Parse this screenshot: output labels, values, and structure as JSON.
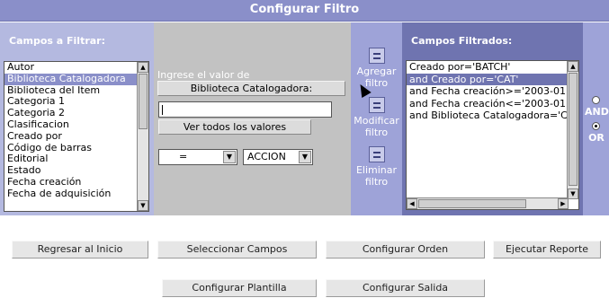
{
  "title": "Configurar Filtro",
  "left": {
    "header": "Campos a Filtrar:",
    "items": [
      "Autor",
      "Biblioteca Catalogadora",
      "Biblioteca del Item",
      "Categoria 1",
      "Categoria 2",
      "Clasificacion",
      "Creado por",
      "Código de barras",
      "Editorial",
      "Estado",
      "Fecha creación",
      "Fecha de adquisición"
    ],
    "selected_index": 1
  },
  "middle": {
    "label": "Ingrese el valor de",
    "field_button": "Biblioteca Catalogadora:",
    "value": "",
    "todos_button": "Ver todos los valores",
    "operator": "=",
    "action": "ACCION"
  },
  "actions": {
    "add": [
      "Agregar",
      "filtro"
    ],
    "modify": [
      "Modificar",
      "filtro"
    ],
    "delete": [
      "Eliminar",
      "filtro"
    ]
  },
  "right": {
    "header": "Campos Filtrados:",
    "items": [
      "Creado por='BATCH'",
      "and Creado por='CAT'",
      "and Fecha creación>='2003-01",
      "and Fecha creación<='2003-01",
      "and Biblioteca Catalogadora='C"
    ],
    "selected_index": 1
  },
  "logic": {
    "and_label": "AND",
    "or_label": "OR",
    "selected": "OR"
  },
  "bottom_buttons": {
    "regresar": "Regresar al Inicio",
    "seleccionar": "Seleccionar Campos",
    "orden": "Configurar Orden",
    "reporte": "Ejecutar Reporte",
    "plantilla": "Configurar Plantilla",
    "salida": "Configurar Salida"
  }
}
